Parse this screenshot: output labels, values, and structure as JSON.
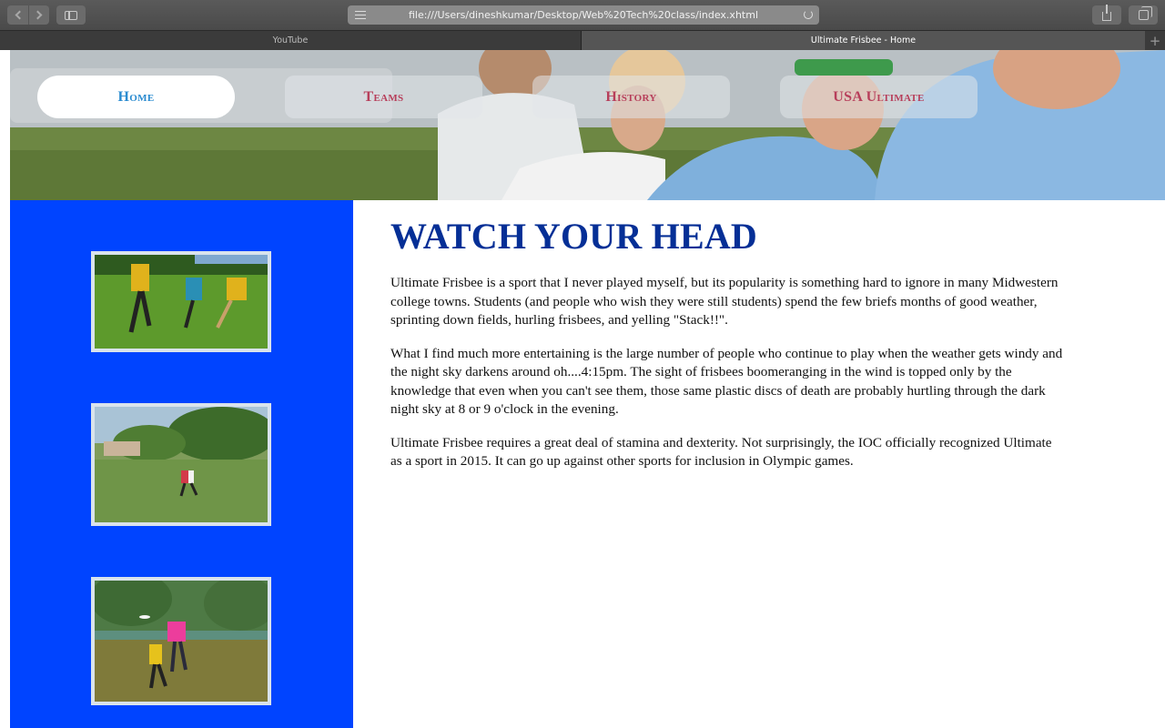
{
  "browser": {
    "url": "file:///Users/dineshkumar/Desktop/Web%20Tech%20class/index.xhtml",
    "tabs": [
      {
        "label": "YouTube",
        "active": false
      },
      {
        "label": "Ultimate Frisbee - Home",
        "active": true
      }
    ],
    "new_tab_label": "+"
  },
  "nav": {
    "items": [
      {
        "label": "Home",
        "active": true
      },
      {
        "label": "Teams",
        "active": false
      },
      {
        "label": "History",
        "active": false
      },
      {
        "label": "USA Ultimate",
        "active": false
      }
    ]
  },
  "sidebar": {
    "background_color": "#0044ff",
    "photos": [
      {
        "name": "frisbee-players-photo-1"
      },
      {
        "name": "frisbee-field-photo-2"
      },
      {
        "name": "frisbee-catch-photo-3"
      }
    ]
  },
  "main": {
    "headline": "WATCH YOUR HEAD",
    "headline_color": "#052f96",
    "paragraphs": [
      "Ultimate Frisbee is a sport that I never played myself, but its popularity is something hard to ignore in many Midwestern college towns. Students (and people who wish they were still students) spend the few briefs months of good weather, sprinting down fields, hurling frisbees, and yelling \"Stack!!\".",
      "What I find much more entertaining is the large number of people who continue to play when the weather gets windy and the night sky darkens around oh....4:15pm. The sight of frisbees boomeranging in the wind is topped only by the knowledge that even when you can't see them, those same plastic discs of death are probably hurtling through the dark night sky at 8 or 9 o'clock in the evening.",
      "Ultimate Frisbee requires a great deal of stamina and dexterity. Not surprisingly, the IOC officially recognized Ultimate as a sport in 2015. It can go up against other sports for inclusion in Olympic games."
    ]
  }
}
